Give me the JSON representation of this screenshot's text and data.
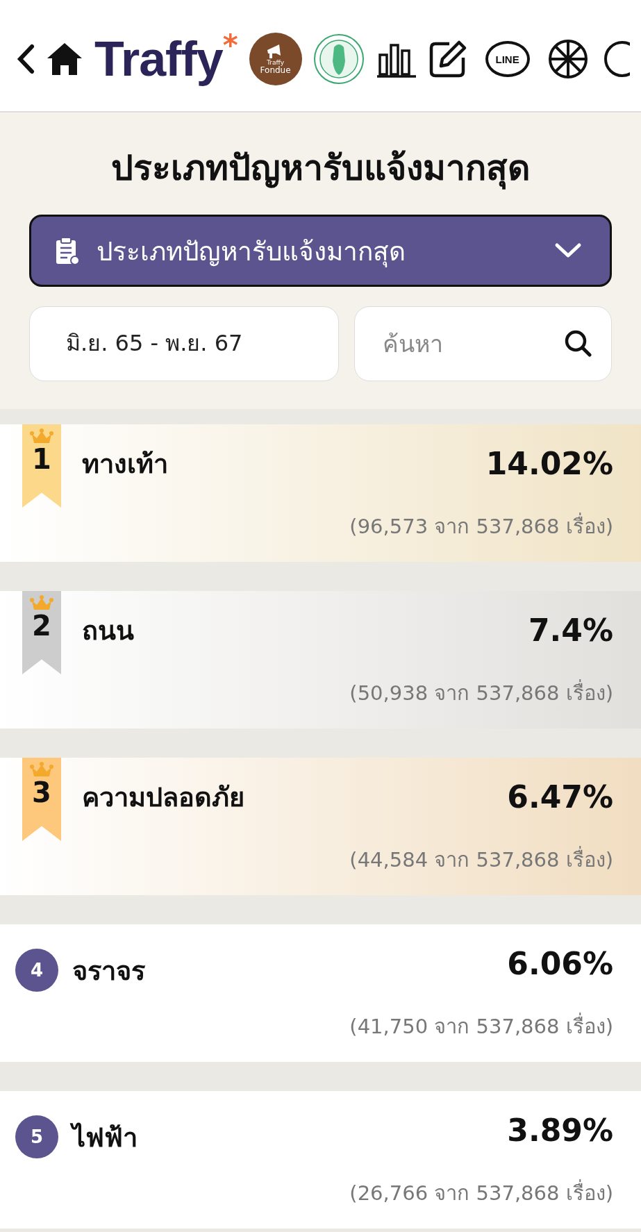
{
  "header": {
    "logo": "Traffy",
    "logo_mark": "*",
    "fondue_small": "Traffy",
    "fondue": "Fondue",
    "line": "LINE"
  },
  "title": "ประเภทปัญหารับแจ้งมากสุด",
  "dropdown": {
    "value": "ประเภทปัญหารับแจ้งมากสุด"
  },
  "date_range": {
    "value": "มิ.ย. 65 - พ.ย. 67"
  },
  "search": {
    "placeholder": "ค้นหา"
  },
  "ranking": [
    {
      "rank": "1",
      "kind": "ribbon",
      "color": "#fcd98a",
      "name": "ทางเท้า",
      "percent": "14.02%",
      "count": "(96,573 จาก 537,868 เรื่อง)"
    },
    {
      "rank": "2",
      "kind": "ribbon",
      "color": "#cdcdcd",
      "name": "ถนน",
      "percent": "7.4%",
      "count": "(50,938 จาก 537,868 เรื่อง)"
    },
    {
      "rank": "3",
      "kind": "ribbon",
      "color": "#fdc77c",
      "name": "ความปลอดภัย",
      "percent": "6.47%",
      "count": "(44,584 จาก 537,868 เรื่อง)"
    },
    {
      "rank": "4",
      "kind": "circle",
      "color": "#5b548e",
      "name": "จราจร",
      "percent": "6.06%",
      "count": "(41,750 จาก 537,868 เรื่อง)"
    },
    {
      "rank": "5",
      "kind": "circle",
      "color": "#5b548e",
      "name": "ไฟฟ้า",
      "percent": "3.89%",
      "count": "(26,766 จาก 537,868 เรื่อง)"
    }
  ]
}
